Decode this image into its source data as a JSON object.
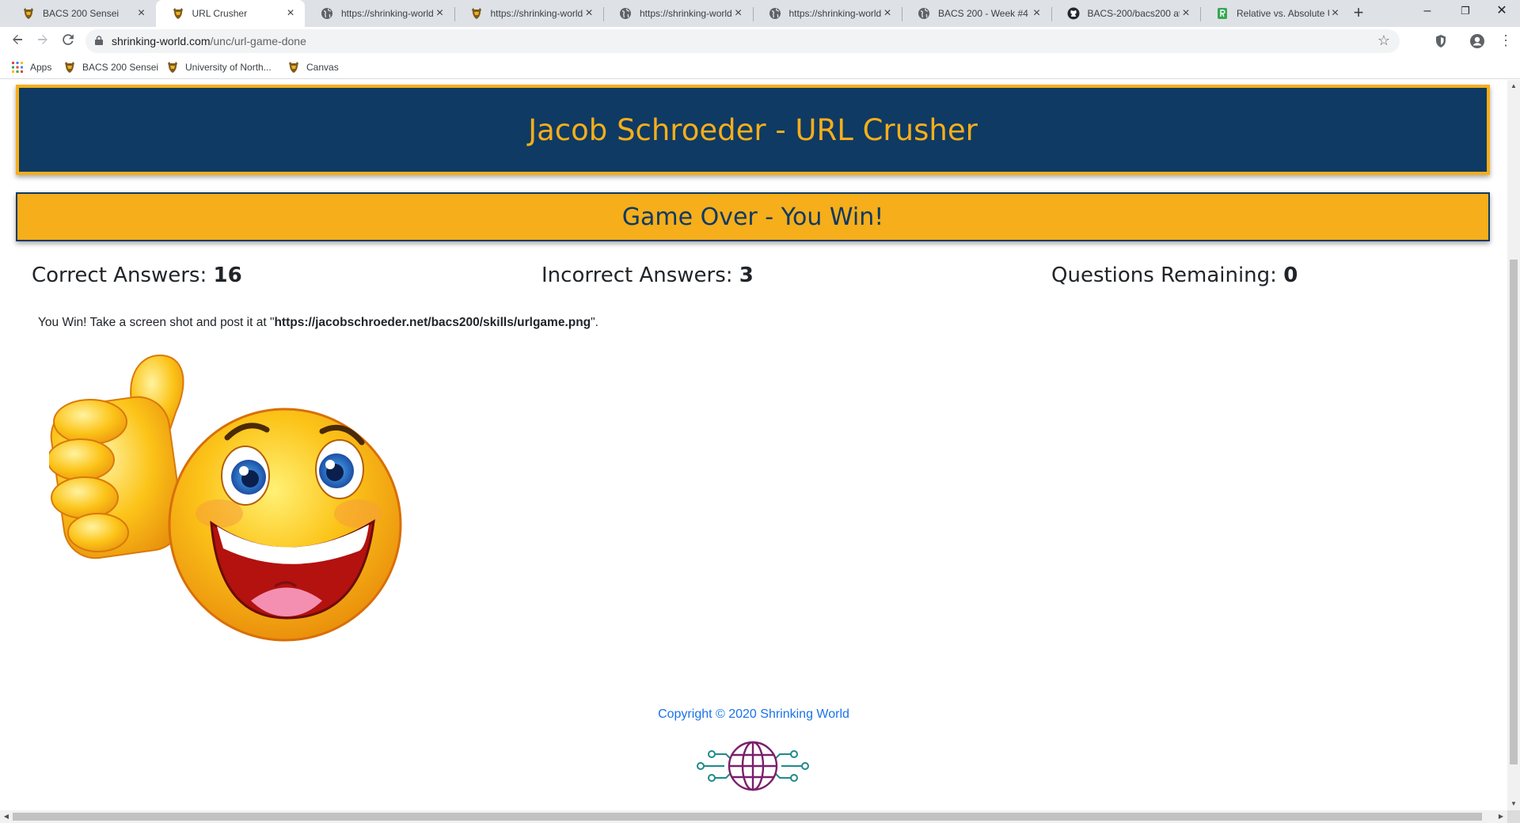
{
  "browser": {
    "tabs": [
      {
        "title": "BACS 200 Sensei",
        "icon": "unc-bear-icon",
        "active": false
      },
      {
        "title": "URL Crusher",
        "icon": "unc-bear-icon",
        "active": true
      },
      {
        "title": "https://shrinking-world",
        "icon": "globe-icon",
        "active": false
      },
      {
        "title": "https://shrinking-world",
        "icon": "unc-bear-icon",
        "active": false
      },
      {
        "title": "https://shrinking-world",
        "icon": "globe-icon",
        "active": false
      },
      {
        "title": "https://shrinking-world",
        "icon": "globe-icon",
        "active": false
      },
      {
        "title": "BACS 200 - Week #4",
        "icon": "globe-icon",
        "active": false
      },
      {
        "title": "BACS-200/bacs200 at m",
        "icon": "github-icon",
        "active": false
      },
      {
        "title": "Relative vs. Absolute U",
        "icon": "document-icon",
        "active": false
      }
    ],
    "new_tab": "+",
    "window_controls": {
      "minimize": "–",
      "restore": "❐",
      "close": "✕"
    },
    "url_host": "shrinking-world.com",
    "url_path": "/unc/url-game-done",
    "bookmarks": [
      {
        "label": "Apps",
        "icon": "apps-grid-icon"
      },
      {
        "label": "BACS 200 Sensei",
        "icon": "unc-bear-icon"
      },
      {
        "label": "University of North...",
        "icon": "unc-bear-icon"
      },
      {
        "label": "Canvas",
        "icon": "unc-bear-icon"
      }
    ]
  },
  "page": {
    "title": "Jacob Schroeder - URL Crusher",
    "status": "Game Over - You Win!",
    "stats": {
      "correct_label": "Correct Answers:",
      "correct_value": "16",
      "incorrect_label": "Incorrect Answers:",
      "incorrect_value": "3",
      "remaining_label": "Questions Remaining:",
      "remaining_value": "0"
    },
    "message_prefix": "You Win! Take a screen shot and post it at \"",
    "message_url": "https://jacobschroeder.net/bacs200/skills/urlgame.png",
    "message_suffix": "\".",
    "copyright": "Copyright © 2020 Shrinking World"
  },
  "colors": {
    "navy": "#0f3a63",
    "gold": "#f6ae1a",
    "link": "#1a73e8"
  }
}
